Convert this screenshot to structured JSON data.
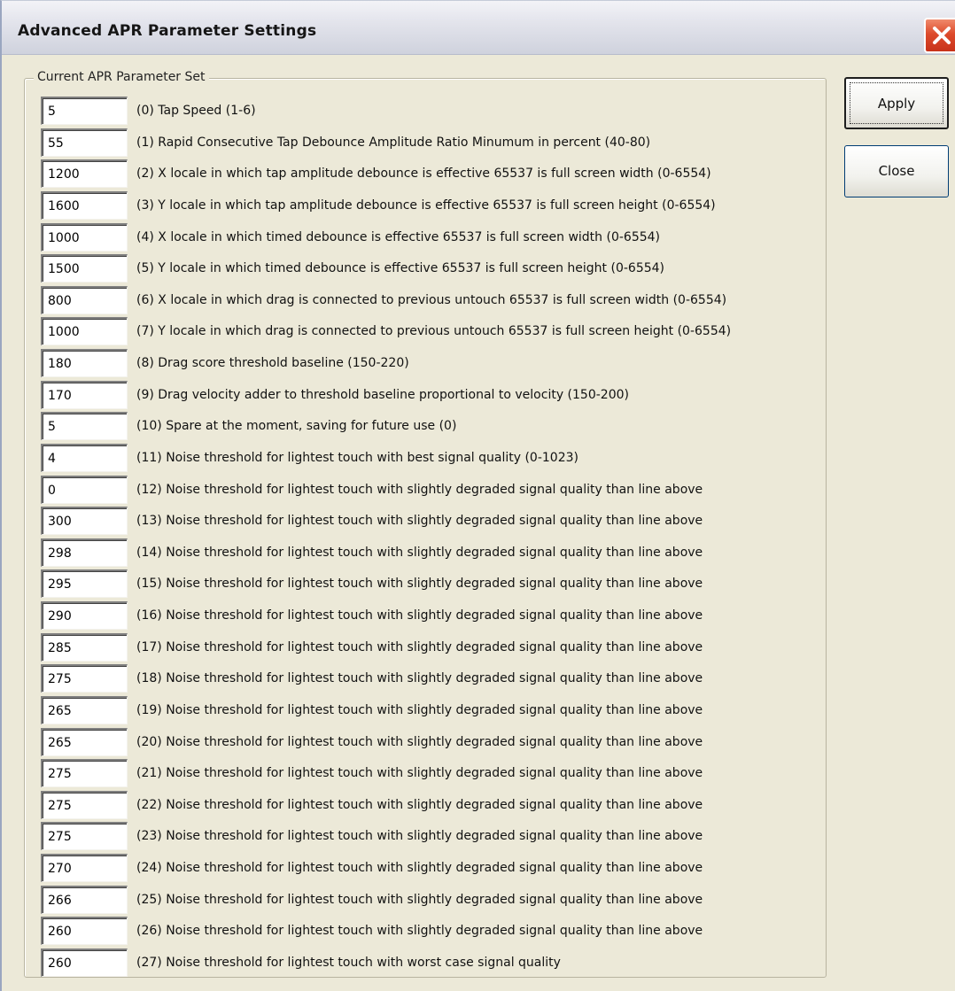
{
  "window": {
    "title": "Advanced APR Parameter Settings"
  },
  "icons": {
    "close": "close-icon"
  },
  "group": {
    "legend": "Current APR Parameter Set"
  },
  "buttons": {
    "apply": "Apply",
    "close": "Close"
  },
  "params": [
    {
      "value": "5",
      "label": "(0)  Tap Speed (1-6)"
    },
    {
      "value": "55",
      "label": "(1)  Rapid Consecutive Tap Debounce Amplitude Ratio Minumum in percent (40-80)"
    },
    {
      "value": "1200",
      "label": "(2)  X locale in which tap amplitude debounce is effective 65537 is full screen width (0-6554)"
    },
    {
      "value": "1600",
      "label": "(3)  Y locale in which tap amplitude debounce is effective 65537 is full screen height (0-6554)"
    },
    {
      "value": "1000",
      "label": "(4)  X locale in which timed debounce is effective 65537 is full screen width (0-6554)"
    },
    {
      "value": "1500",
      "label": "(5)  Y locale in which timed debounce is effective 65537 is full screen height (0-6554)"
    },
    {
      "value": "800",
      "label": "(6)  X locale in which drag is connected to previous untouch 65537 is full screen width (0-6554)"
    },
    {
      "value": "1000",
      "label": "(7)  Y locale in which drag is connected to previous untouch 65537 is full screen height (0-6554)"
    },
    {
      "value": "180",
      "label": "(8)  Drag score threshold baseline (150-220)"
    },
    {
      "value": "170",
      "label": "(9)  Drag velocity adder to threshold baseline proportional to velocity (150-200)"
    },
    {
      "value": "5",
      "label": "(10)  Spare at the moment, saving for future use (0)"
    },
    {
      "value": "4",
      "label": "(11)  Noise threshold for lightest touch with best signal quality (0-1023)"
    },
    {
      "value": "0",
      "label": "(12)  Noise threshold for lightest touch with slightly degraded signal quality than line above"
    },
    {
      "value": "300",
      "label": "(13)  Noise threshold for lightest touch with slightly degraded signal quality than line above"
    },
    {
      "value": "298",
      "label": "(14)  Noise threshold for lightest touch with slightly degraded signal quality than line above"
    },
    {
      "value": "295",
      "label": "(15)  Noise threshold for lightest touch with slightly degraded signal quality than line above"
    },
    {
      "value": "290",
      "label": "(16)  Noise threshold for lightest touch with slightly degraded signal quality than line above"
    },
    {
      "value": "285",
      "label": "(17)  Noise threshold for lightest touch with slightly degraded signal quality than line above"
    },
    {
      "value": "275",
      "label": "(18)  Noise threshold for lightest touch with slightly degraded signal quality than line above"
    },
    {
      "value": "265",
      "label": "(19)  Noise threshold for lightest touch with slightly degraded signal quality than line above"
    },
    {
      "value": "265",
      "label": "(20)  Noise threshold for lightest touch with slightly degraded signal quality than line above"
    },
    {
      "value": "275",
      "label": "(21)  Noise threshold for lightest touch with slightly degraded signal quality than line above"
    },
    {
      "value": "275",
      "label": "(22)  Noise threshold for lightest touch with slightly degraded signal quality than line above"
    },
    {
      "value": "275",
      "label": "(23)  Noise threshold for lightest touch with slightly degraded signal quality than line above"
    },
    {
      "value": "270",
      "label": "(24)  Noise threshold for lightest touch with slightly degraded signal quality than line above"
    },
    {
      "value": "266",
      "label": "(25)  Noise threshold for lightest touch with slightly degraded signal quality than line above"
    },
    {
      "value": "260",
      "label": "(26)  Noise threshold for lightest touch with slightly degraded signal quality than line above"
    },
    {
      "value": "260",
      "label": "(27)  Noise threshold for lightest touch with worst case signal quality"
    }
  ]
}
